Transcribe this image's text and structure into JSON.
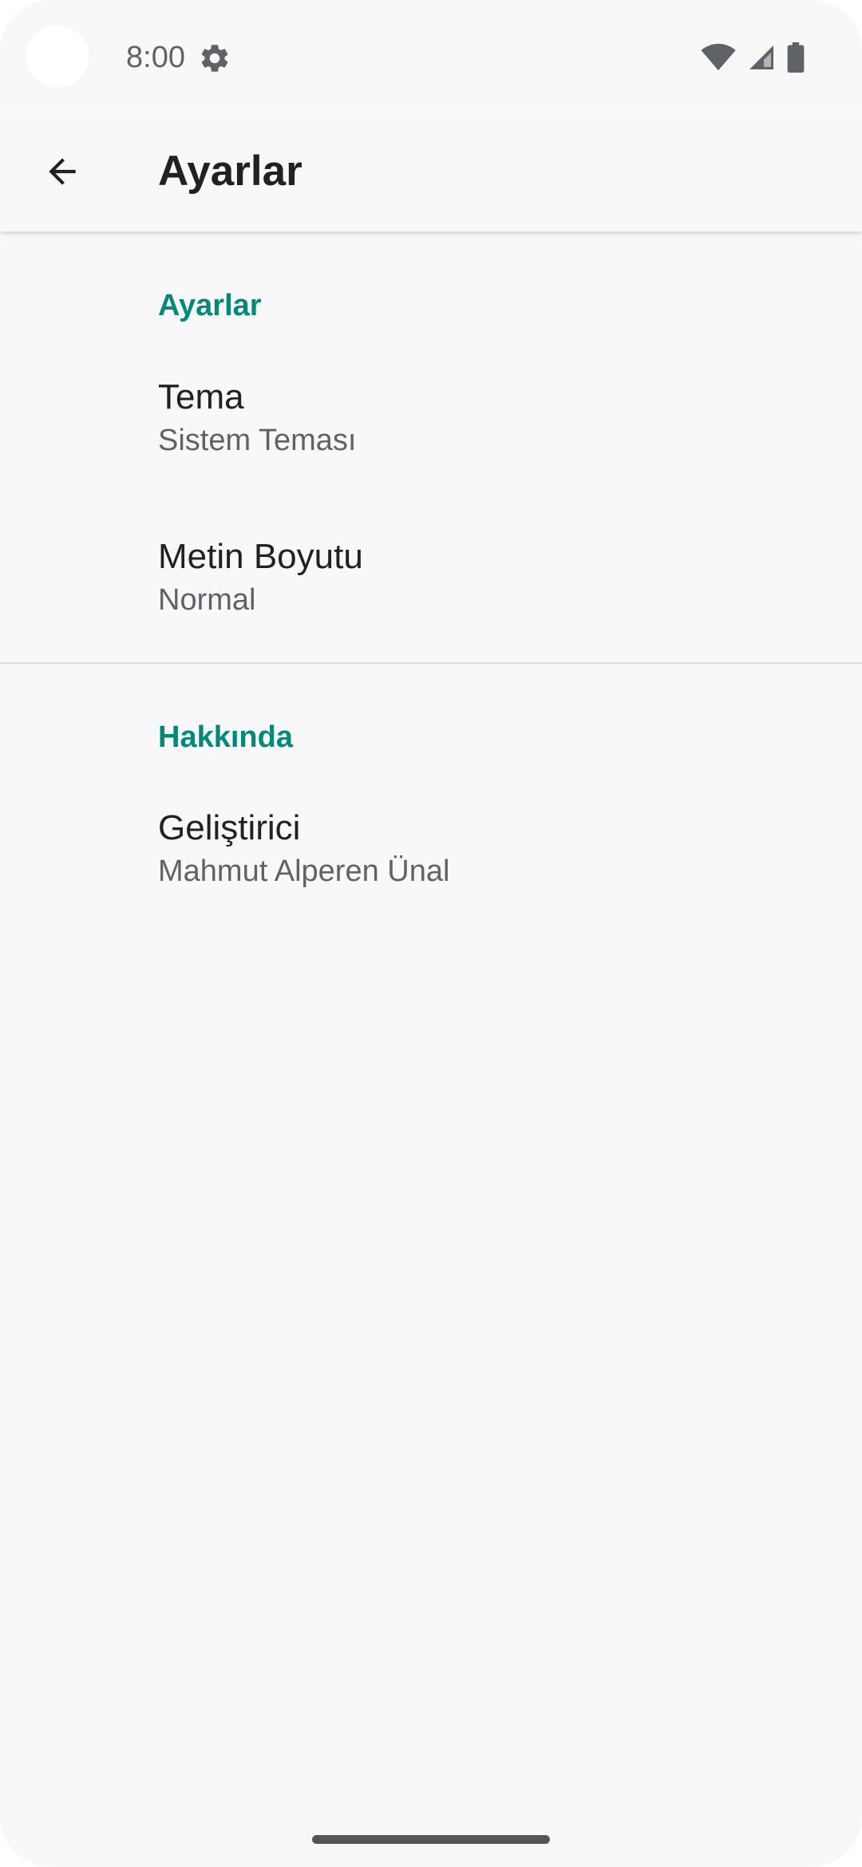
{
  "status_bar": {
    "time": "8:00",
    "icons": [
      "gear-icon",
      "wifi-icon",
      "signal-icon",
      "battery-icon"
    ]
  },
  "app_bar": {
    "title": "Ayarlar",
    "back_icon": "arrow-back-icon"
  },
  "categories": [
    {
      "title": "Ayarlar",
      "items": [
        {
          "title": "Tema",
          "summary": "Sistem Teması"
        },
        {
          "title": "Metin Boyutu",
          "summary": "Normal"
        }
      ]
    },
    {
      "title": "Hakkında",
      "items": [
        {
          "title": "Geliştirici",
          "summary": "Mahmut Alperen Ünal"
        }
      ]
    }
  ],
  "colors": {
    "accent": "#00897b",
    "background": "#f8f8f8",
    "title_text": "#202124",
    "summary_text": "#5f6368"
  }
}
